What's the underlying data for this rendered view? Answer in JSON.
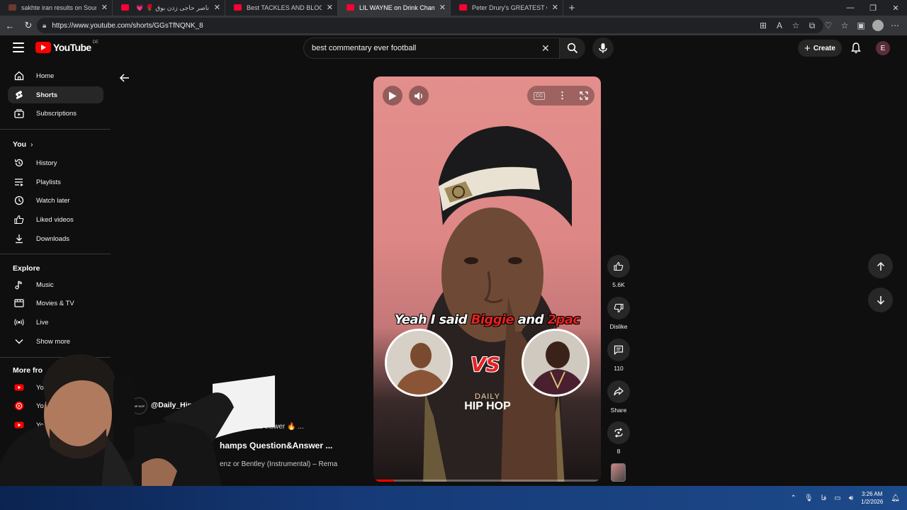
{
  "browser": {
    "tabs": [
      {
        "title": "sakhte iran results on SoundCloud",
        "favicon": "soundcloud-favicon",
        "active": false
      },
      {
        "title": "ناصر حاجی زدن بوق 🌹 💗 - YouTube",
        "favicon": "youtube-favicon",
        "active": false
      },
      {
        "title": "Best TACKLES AND BLOCKS | Serg",
        "favicon": "youtube-favicon",
        "active": false
      },
      {
        "title": "LIL WAYNE on Drink Champs Qu",
        "favicon": "youtube-favicon",
        "active": true
      },
      {
        "title": "Peter Drury's GREATEST Commen",
        "favicon": "youtube-favicon",
        "active": false
      }
    ],
    "url": "https://www.youtube.com/shorts/GGsTfNQNK_8"
  },
  "masthead": {
    "logo_text": "YouTube",
    "region": "DE",
    "search_query": "best commentary ever football",
    "create_label": "Create",
    "avatar_letter": "E"
  },
  "sidebar": {
    "main": [
      {
        "label": "Home",
        "icon": "home-icon"
      },
      {
        "label": "Shorts",
        "icon": "shorts-icon",
        "active": true
      },
      {
        "label": "Subscriptions",
        "icon": "subscriptions-icon"
      }
    ],
    "you_heading": "You",
    "you": [
      {
        "label": "History",
        "icon": "history-icon"
      },
      {
        "label": "Playlists",
        "icon": "playlists-icon"
      },
      {
        "label": "Watch later",
        "icon": "watch-later-icon"
      },
      {
        "label": "Liked videos",
        "icon": "liked-videos-icon"
      },
      {
        "label": "Downloads",
        "icon": "downloads-icon"
      }
    ],
    "explore_heading": "Explore",
    "explore": [
      {
        "label": "Music",
        "icon": "music-icon"
      },
      {
        "label": "Movies & TV",
        "icon": "movies-icon"
      },
      {
        "label": "Live",
        "icon": "live-icon"
      },
      {
        "label": "Show more",
        "icon": "chevron-down-icon"
      }
    ],
    "more_heading": "More fro",
    "more": [
      {
        "label": "Yo",
        "icon": "youtube-premium-icon"
      },
      {
        "label": "Yo",
        "icon": "youtube-music-icon"
      },
      {
        "label": "Yo",
        "icon": "youtube-kids-icon"
      }
    ]
  },
  "video": {
    "caption_parts": [
      "Yeah I said ",
      "Biggie",
      " and ",
      "2pac"
    ],
    "vs_text": "VS",
    "brand_line1": "DAILY",
    "brand_line2": "HIP HOP",
    "progress_percent": 9
  },
  "actions": {
    "likes": "5.6K",
    "dislike": "Dislike",
    "comments": "110",
    "share": "Share",
    "remix": "8"
  },
  "meta": {
    "channel": "@Daily_Hip_Hop",
    "channel_avatar_text": "HIP HOP",
    "description": "uestion&Answer 🔥 ...",
    "title": "hamps Question&Answer ...",
    "sound": "enz or Bentley (Instrumental) – Rema"
  },
  "taskbar": {
    "time": "3:26 AM",
    "date": "1/2/2026",
    "lang": "فا"
  },
  "colors": {
    "brand_red": "#ff0000",
    "caption_red": "#e52222",
    "background": "#0f0f0f"
  }
}
